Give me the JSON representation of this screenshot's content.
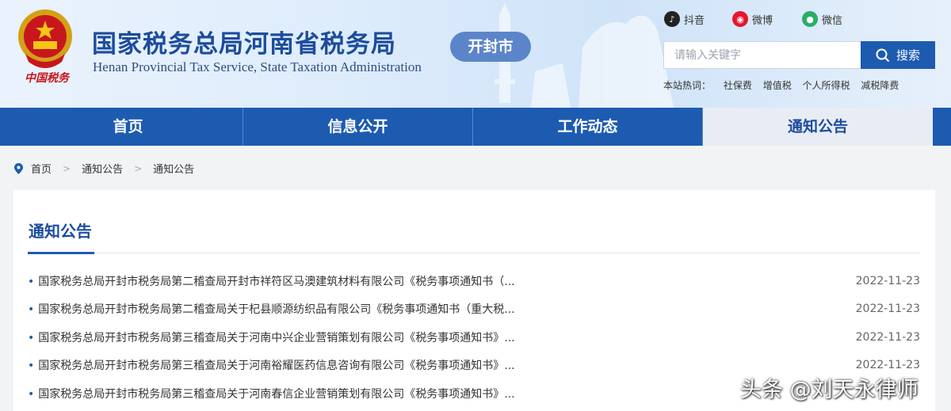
{
  "header": {
    "emblem_caption": "中国税务",
    "title": "国家税务总局河南省税务局",
    "subtitle": "Henan Provincial Tax Service, State Taxation Administration",
    "city_badge": "开封市",
    "social": [
      {
        "name": "douyin",
        "label": "抖音",
        "color": "#222222"
      },
      {
        "name": "weibo",
        "label": "微博",
        "color": "#e6162d"
      },
      {
        "name": "wechat",
        "label": "微信",
        "color": "#2aae67"
      }
    ],
    "search": {
      "placeholder": "请输入关键字",
      "button_label": "搜索"
    },
    "hot": {
      "label": "本站热词：",
      "terms": [
        "社保费",
        "增值税",
        "个人所得税",
        "减税降费"
      ]
    }
  },
  "nav": {
    "items": [
      {
        "label": "首页",
        "active": false
      },
      {
        "label": "信息公开",
        "active": false
      },
      {
        "label": "工作动态",
        "active": false
      },
      {
        "label": "通知公告",
        "active": true
      }
    ]
  },
  "breadcrumb": [
    "首页",
    "通知公告",
    "通知公告"
  ],
  "main": {
    "section_title": "通知公告",
    "notices": [
      {
        "title": "国家税务总局开封市税务局第二稽查局开封市祥符区马澳建筑材料有限公司《税务事项通知书（...",
        "date": "2022-11-23"
      },
      {
        "title": "国家税务总局开封市税务局第二稽查局关于杞县顺源纺织品有限公司《税务事项通知书（重大税...",
        "date": "2022-11-23"
      },
      {
        "title": "国家税务总局开封市税务局第三稽查局关于河南中兴企业营销策划有限公司《税务事项通知书》...",
        "date": "2022-11-23"
      },
      {
        "title": "国家税务总局开封市税务局第三稽查局关于河南裕耀医药信息咨询有限公司《税务事项通知书》...",
        "date": "2022-11-23"
      },
      {
        "title": "国家税务总局开封市税务局第三稽查局关于河南春信企业营销策划有限公司《税务事项通知书》...",
        "date": ""
      }
    ]
  },
  "watermark": "头条 @刘天永律师",
  "colors": {
    "brand_blue": "#1d5bb1",
    "title_blue": "#1c4c9c",
    "emblem_red": "#c8161d"
  }
}
